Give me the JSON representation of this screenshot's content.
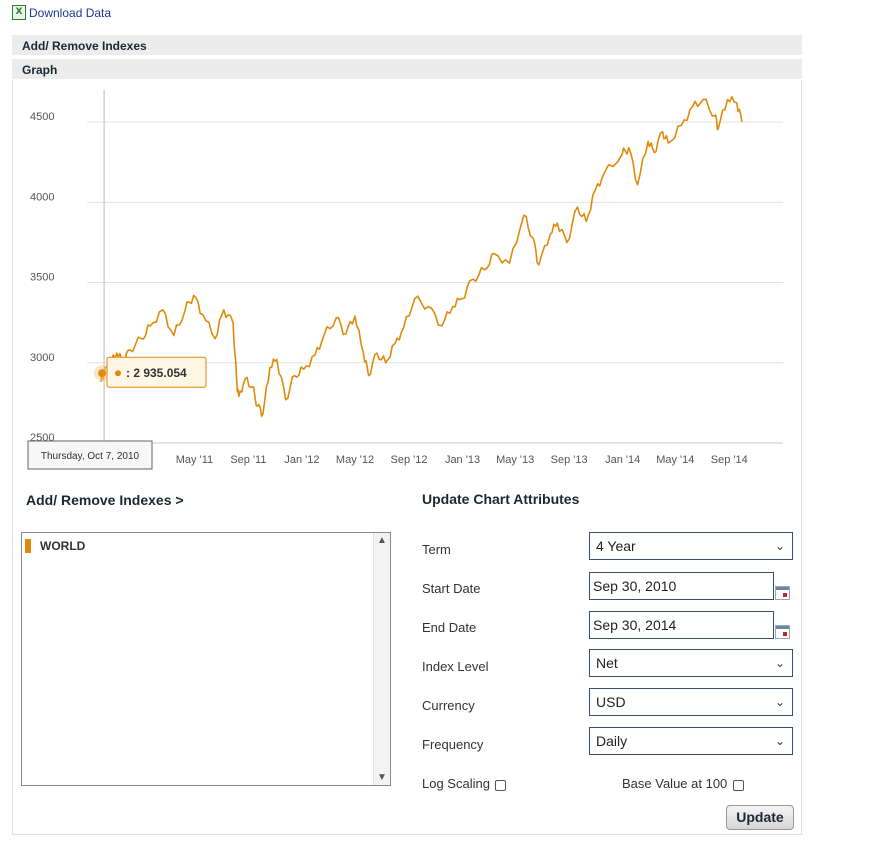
{
  "download": {
    "label": "Download Data",
    "icon": "excel-icon"
  },
  "sections": {
    "add_remove": "Add/ Remove Indexes",
    "graph": "Graph"
  },
  "chart_data": {
    "type": "line",
    "series": [
      {
        "name": "WORLD",
        "color": "#e08a0b",
        "points": [
          [
            "2010-09-30",
            2880
          ],
          [
            "2010-10-07",
            2935
          ],
          [
            "2010-10-20",
            2990
          ],
          [
            "2010-11-05",
            3060
          ],
          [
            "2010-11-20",
            3000
          ],
          [
            "2010-12-05",
            3080
          ],
          [
            "2010-12-31",
            3150
          ],
          [
            "2011-01-20",
            3230
          ],
          [
            "2011-02-18",
            3330
          ],
          [
            "2011-03-15",
            3170
          ],
          [
            "2011-04-10",
            3330
          ],
          [
            "2011-04-29",
            3420
          ],
          [
            "2011-05-20",
            3300
          ],
          [
            "2011-06-17",
            3150
          ],
          [
            "2011-07-07",
            3330
          ],
          [
            "2011-07-28",
            3250
          ],
          [
            "2011-08-05",
            2900
          ],
          [
            "2011-08-10",
            2790
          ],
          [
            "2011-08-25",
            2900
          ],
          [
            "2011-09-10",
            2850
          ],
          [
            "2011-09-22",
            2730
          ],
          [
            "2011-10-04",
            2680
          ],
          [
            "2011-10-20",
            2970
          ],
          [
            "2011-11-05",
            3020
          ],
          [
            "2011-11-25",
            2770
          ],
          [
            "2011-12-15",
            2920
          ],
          [
            "2012-01-05",
            2960
          ],
          [
            "2012-01-31",
            3050
          ],
          [
            "2012-02-20",
            3170
          ],
          [
            "2012-03-19",
            3280
          ],
          [
            "2012-04-10",
            3180
          ],
          [
            "2012-05-01",
            3290
          ],
          [
            "2012-05-20",
            3060
          ],
          [
            "2012-06-01",
            2920
          ],
          [
            "2012-06-20",
            3060
          ],
          [
            "2012-07-10",
            3000
          ],
          [
            "2012-07-31",
            3120
          ],
          [
            "2012-08-20",
            3220
          ],
          [
            "2012-09-14",
            3400
          ],
          [
            "2012-10-15",
            3350
          ],
          [
            "2012-11-15",
            3230
          ],
          [
            "2012-12-10",
            3350
          ],
          [
            "2012-12-31",
            3400
          ],
          [
            "2013-01-25",
            3520
          ],
          [
            "2013-02-20",
            3580
          ],
          [
            "2013-03-15",
            3680
          ],
          [
            "2013-04-18",
            3620
          ],
          [
            "2013-05-21",
            3920
          ],
          [
            "2013-06-10",
            3780
          ],
          [
            "2013-06-24",
            3610
          ],
          [
            "2013-07-20",
            3800
          ],
          [
            "2013-08-05",
            3870
          ],
          [
            "2013-08-27",
            3750
          ],
          [
            "2013-09-20",
            3970
          ],
          [
            "2013-10-10",
            3880
          ],
          [
            "2013-10-31",
            4080
          ],
          [
            "2013-11-20",
            4180
          ],
          [
            "2013-12-31",
            4300
          ],
          [
            "2014-01-15",
            4340
          ],
          [
            "2014-02-04",
            4110
          ],
          [
            "2014-02-28",
            4380
          ],
          [
            "2014-03-14",
            4310
          ],
          [
            "2014-04-02",
            4440
          ],
          [
            "2014-04-15",
            4370
          ],
          [
            "2014-05-15",
            4480
          ],
          [
            "2014-06-10",
            4600
          ],
          [
            "2014-07-03",
            4640
          ],
          [
            "2014-07-31",
            4540
          ],
          [
            "2014-08-07",
            4460
          ],
          [
            "2014-08-28",
            4640
          ],
          [
            "2014-09-18",
            4620
          ],
          [
            "2014-09-30",
            4500
          ]
        ]
      }
    ],
    "x_ticks": [
      "May '11",
      "Sep '11",
      "Jan '12",
      "May '12",
      "Sep '12",
      "Jan '13",
      "May '13",
      "Sep '13",
      "Jan '14",
      "May '14",
      "Sep '14"
    ],
    "x_tick_dates": [
      "2011-05-01",
      "2011-09-01",
      "2012-01-01",
      "2012-05-01",
      "2012-09-01",
      "2013-01-01",
      "2013-05-01",
      "2013-09-01",
      "2014-01-01",
      "2014-05-01",
      "2014-09-01"
    ],
    "y_ticks": [
      2500,
      3000,
      3500,
      4000,
      4500
    ],
    "xlim": [
      "2010-09-30",
      "2014-09-30"
    ],
    "ylim": [
      2500,
      4700
    ],
    "grid": "horizontal",
    "tooltip": {
      "date": "2010-10-07",
      "date_label": "Thursday, Oct 7, 2010",
      "value": 2935.054,
      "value_label": ": 2 935.054"
    }
  },
  "indexes": {
    "heading": "Add/ Remove Indexes >",
    "items": [
      {
        "label": "WORLD",
        "color": "#e08a0b"
      }
    ]
  },
  "attributes": {
    "heading": "Update Chart Attributes",
    "term": {
      "label": "Term",
      "value": "4 Year"
    },
    "start_date": {
      "label": "Start Date",
      "value": "Sep 30, 2010"
    },
    "end_date": {
      "label": "End Date",
      "value": "Sep 30, 2014"
    },
    "index_level": {
      "label": "Index Level",
      "value": "Net"
    },
    "currency": {
      "label": "Currency",
      "value": "USD"
    },
    "frequency": {
      "label": "Frequency",
      "value": "Daily"
    },
    "log_scaling": {
      "label": "Log Scaling",
      "checked": false
    },
    "base_value": {
      "label": "Base Value at 100",
      "checked": false
    },
    "update_label": "Update"
  }
}
